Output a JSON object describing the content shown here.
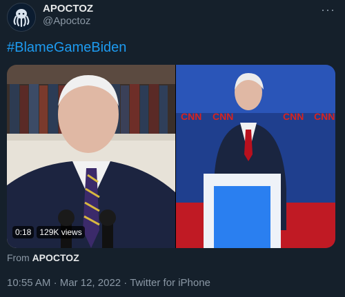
{
  "author": {
    "display_name": "APOCTOZ",
    "handle": "@Apoctoz",
    "avatar_icon": "octopus-logo-icon"
  },
  "more_label": "···",
  "tweet_text": "#BlameGameBiden",
  "media": {
    "duration": "0:18",
    "views": "129K views",
    "right_panel_logos": [
      "CNN",
      "CNN",
      "CNN",
      "CNN"
    ]
  },
  "source": {
    "prefix": "From",
    "name": "APOCTOZ"
  },
  "meta": {
    "time": "10:55 AM",
    "separator1": "·",
    "date": "Mar 12, 2022",
    "separator2": "·",
    "client": "Twitter for iPhone"
  },
  "colors": {
    "background": "#15202b",
    "link": "#1d9bf0",
    "secondary_text": "#8b98a5"
  }
}
